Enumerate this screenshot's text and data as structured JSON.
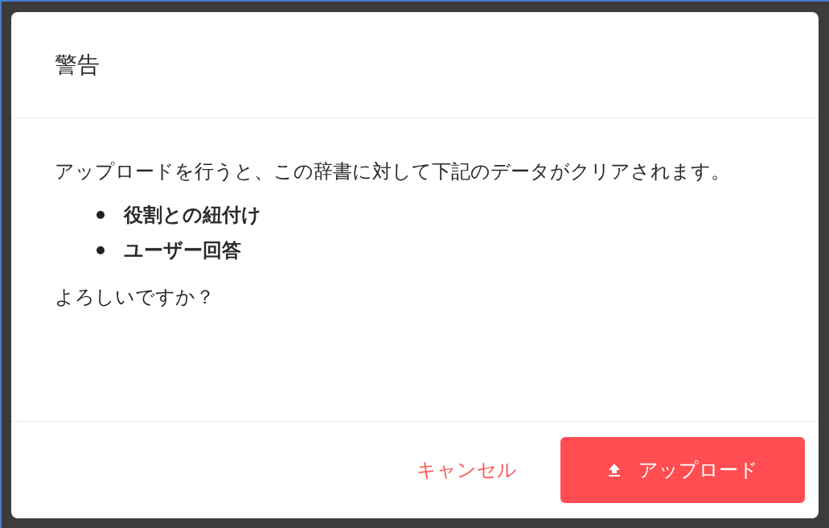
{
  "dialog": {
    "title": "警告",
    "message": "アップロードを行うと、この辞書に対して下記のデータがクリアされます。",
    "items": [
      "役割との紐付け",
      "ユーザー回答"
    ],
    "question": "よろしいですか？",
    "buttons": [
      {
        "label": "キャンセル",
        "kind": "text"
      },
      {
        "label": "アップロード",
        "kind": "primary"
      }
    ]
  }
}
